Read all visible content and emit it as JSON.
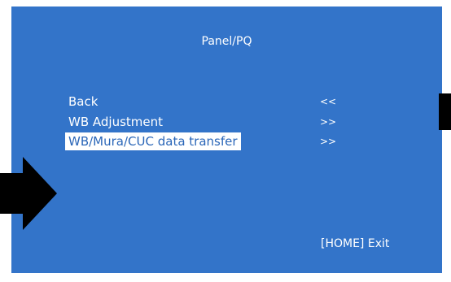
{
  "osd": {
    "title": "Panel/PQ",
    "menu": [
      {
        "label": "Back",
        "arrow": "<<"
      },
      {
        "label": "WB Adjustment",
        "arrow": ">>"
      },
      {
        "label": "WB/Mura/CUC data transfer",
        "arrow": ">>",
        "selected": true
      }
    ],
    "exit_hint": "[HOME] Exit"
  },
  "colors": {
    "panel_background": "#3374c9",
    "text": "#ffffff",
    "highlight_background": "#ffffff",
    "highlight_text": "#2a66b8",
    "overlay_arrow": "#000000"
  },
  "icons": {
    "pointer_arrow": "right-arrow-icon",
    "edge_marker": "black-tab-icon"
  }
}
